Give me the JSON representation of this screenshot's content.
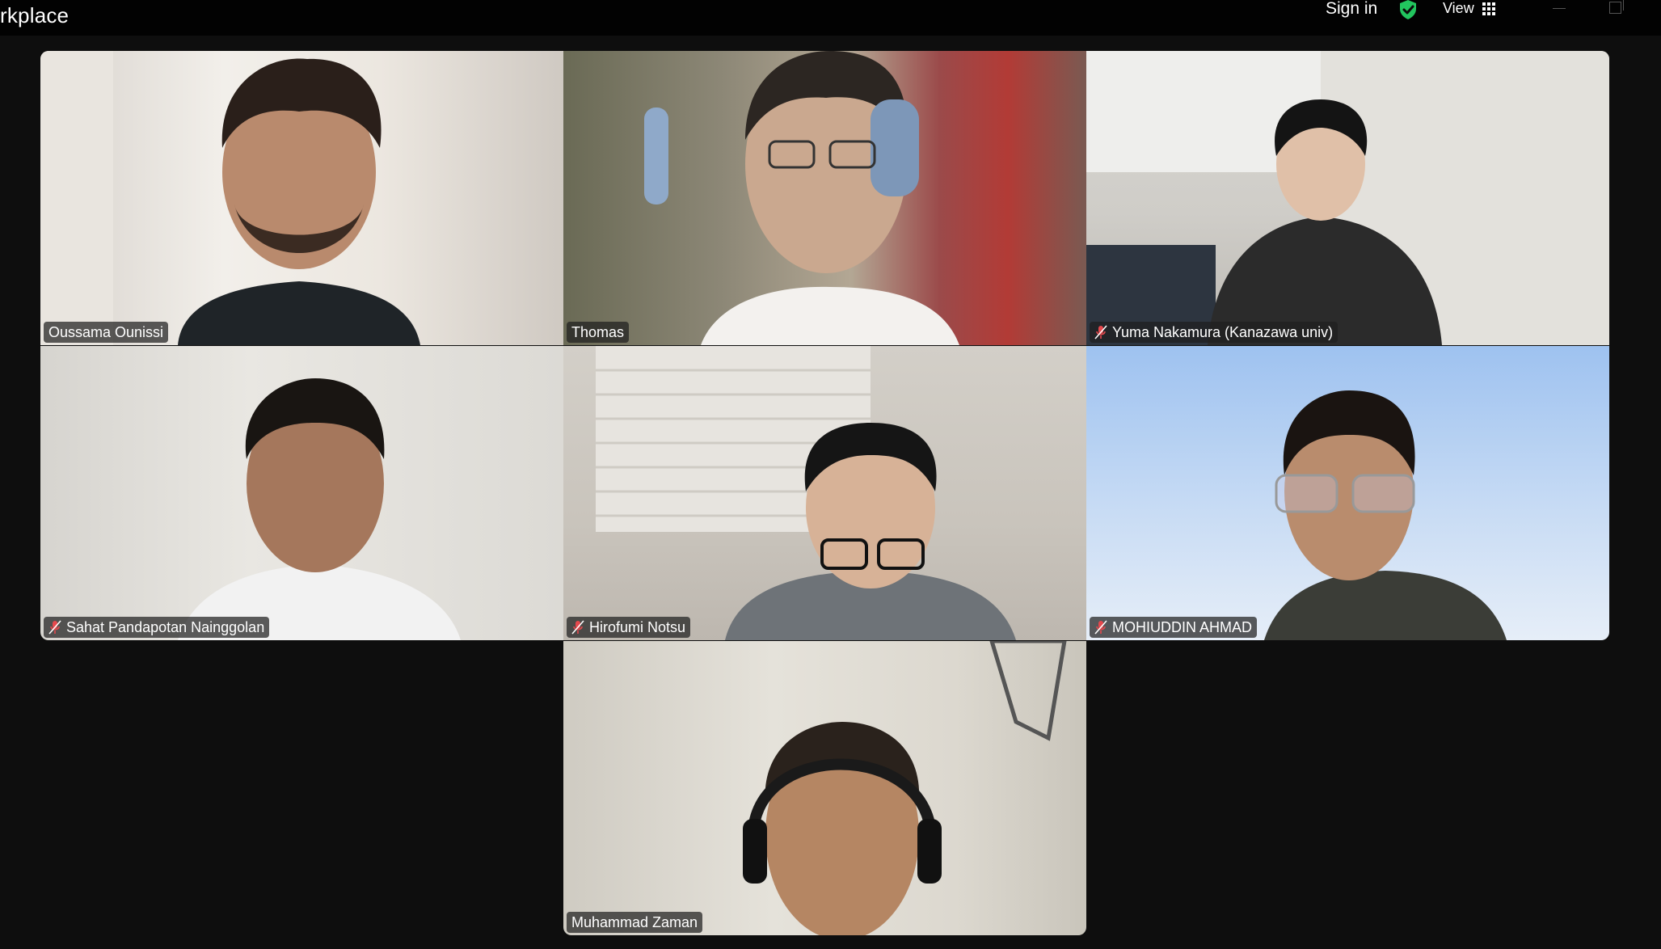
{
  "app": {
    "title_fragment": "rkplace",
    "sign_in_label": "Sign in",
    "view_label": "View"
  },
  "icons": {
    "security": "shield-check-icon",
    "view": "grid-icon",
    "muted": "mic-muted-icon"
  },
  "colors": {
    "active_speaker_border": "#23d28e",
    "shield": "#22c55e",
    "muted_mic": "#e5484d"
  },
  "participants": [
    {
      "name": "Oussama Ounissi",
      "muted": false,
      "active": false
    },
    {
      "name": "Thomas",
      "muted": false,
      "active": true
    },
    {
      "name": "Yuma Nakamura (Kanazawa univ)",
      "muted": true,
      "active": false
    },
    {
      "name": "Sahat Pandapotan Nainggolan",
      "muted": true,
      "active": false
    },
    {
      "name": "Hirofumi Notsu",
      "muted": true,
      "active": false
    },
    {
      "name": "MOHIUDDIN AHMAD",
      "muted": true,
      "active": false
    },
    {
      "name": "Muhammad Zaman",
      "muted": false,
      "active": false
    }
  ]
}
